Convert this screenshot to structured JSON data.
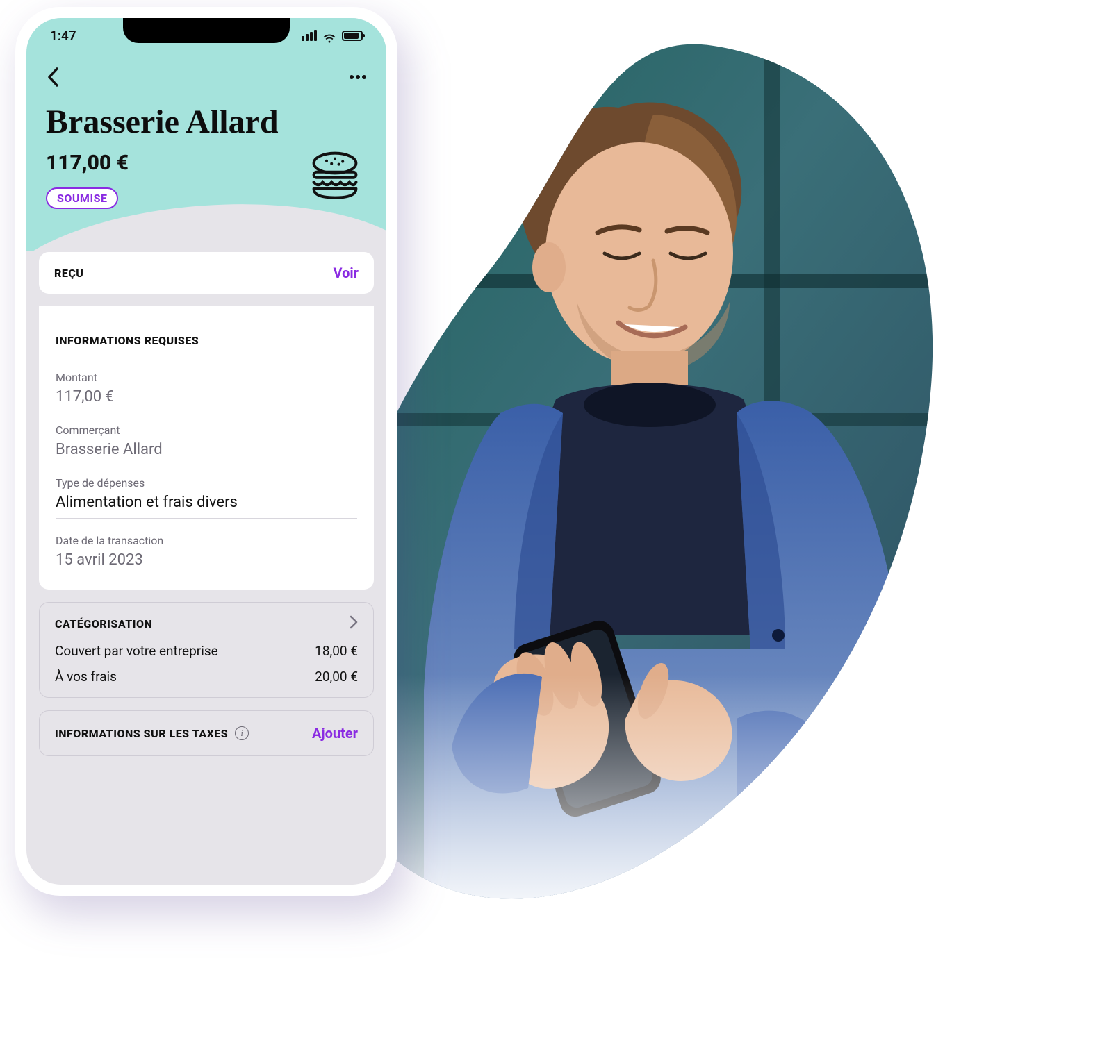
{
  "status_bar": {
    "time": "1:47"
  },
  "header": {
    "merchant": "Brasserie Allard",
    "amount": "117,00 €",
    "status_pill": "SOUMISE"
  },
  "receipt_row": {
    "label": "REÇU",
    "action": "Voir"
  },
  "required_info": {
    "title": "INFORMATIONS REQUISES",
    "fields": {
      "amount_label": "Montant",
      "amount_value": "117,00 €",
      "merchant_label": "Commerçant",
      "merchant_value": "Brasserie Allard",
      "expense_type_label": "Type de dépenses",
      "expense_type_value": "Alimentation et frais divers",
      "date_label": "Date de la transaction",
      "date_value": "15 avril 2023"
    }
  },
  "categorisation": {
    "title": "CATÉGORISATION",
    "rows": [
      {
        "label": "Couvert par votre entreprise",
        "value": "18,00 €"
      },
      {
        "label": "À vos frais",
        "value": "20,00 €"
      }
    ]
  },
  "taxes": {
    "title": "INFORMATIONS SUR LES TAXES",
    "action": "Ajouter"
  }
}
